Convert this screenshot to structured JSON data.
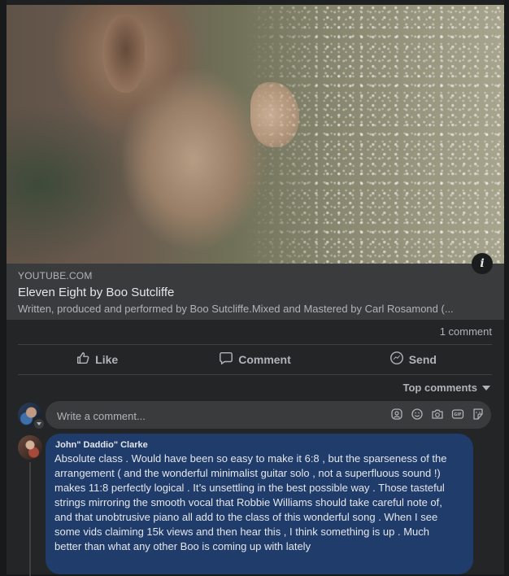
{
  "link_preview": {
    "domain": "YOUTUBE.COM",
    "title": "Eleven Eight by Boo Sutcliffe",
    "description": "Written, produced and performed by Boo Sutcliffe.Mixed and Mastered by Carl Rosamond (..."
  },
  "info_button": "i",
  "stats": {
    "comments": "1 comment"
  },
  "actions": [
    {
      "label": "Like",
      "icon": "thumbs-up-icon"
    },
    {
      "label": "Comment",
      "icon": "comment-bubble-icon"
    },
    {
      "label": "Send",
      "icon": "messenger-icon"
    }
  ],
  "sort": {
    "label": "Top comments",
    "icon": "caret-down-icon"
  },
  "composer": {
    "placeholder": "Write a comment...",
    "icons": [
      "avatar-sticker-icon",
      "emoji-icon",
      "camera-icon",
      "gif-icon",
      "sticker-icon"
    ]
  },
  "comment": {
    "author": "John\" Daddio\" Clarke",
    "text": "Absolute class . Would have been so easy to make it 6:8 , but the sparseness of the arrangement ( and the wonderful minimalist guitar solo , not a superfluous sound !) makes 11:8 perfectly logical . It’s unsettling in the best possible way . Those tasteful strings mirroring the smooth vocal that Robbie Williams should take careful note of, and that unobtrusive piano all add to the class of this wonderful song . When I see some vids claiming 15k views and then hear this , I think something is up . Much better than what any other Boo is coming up with lately"
  },
  "colors": {
    "background": "#18191a",
    "card": "#242526",
    "surface": "#3a3b3c",
    "comment_bubble": "#1f3c6b",
    "text_primary": "#e4e6eb",
    "text_secondary": "#b0b3b8"
  }
}
